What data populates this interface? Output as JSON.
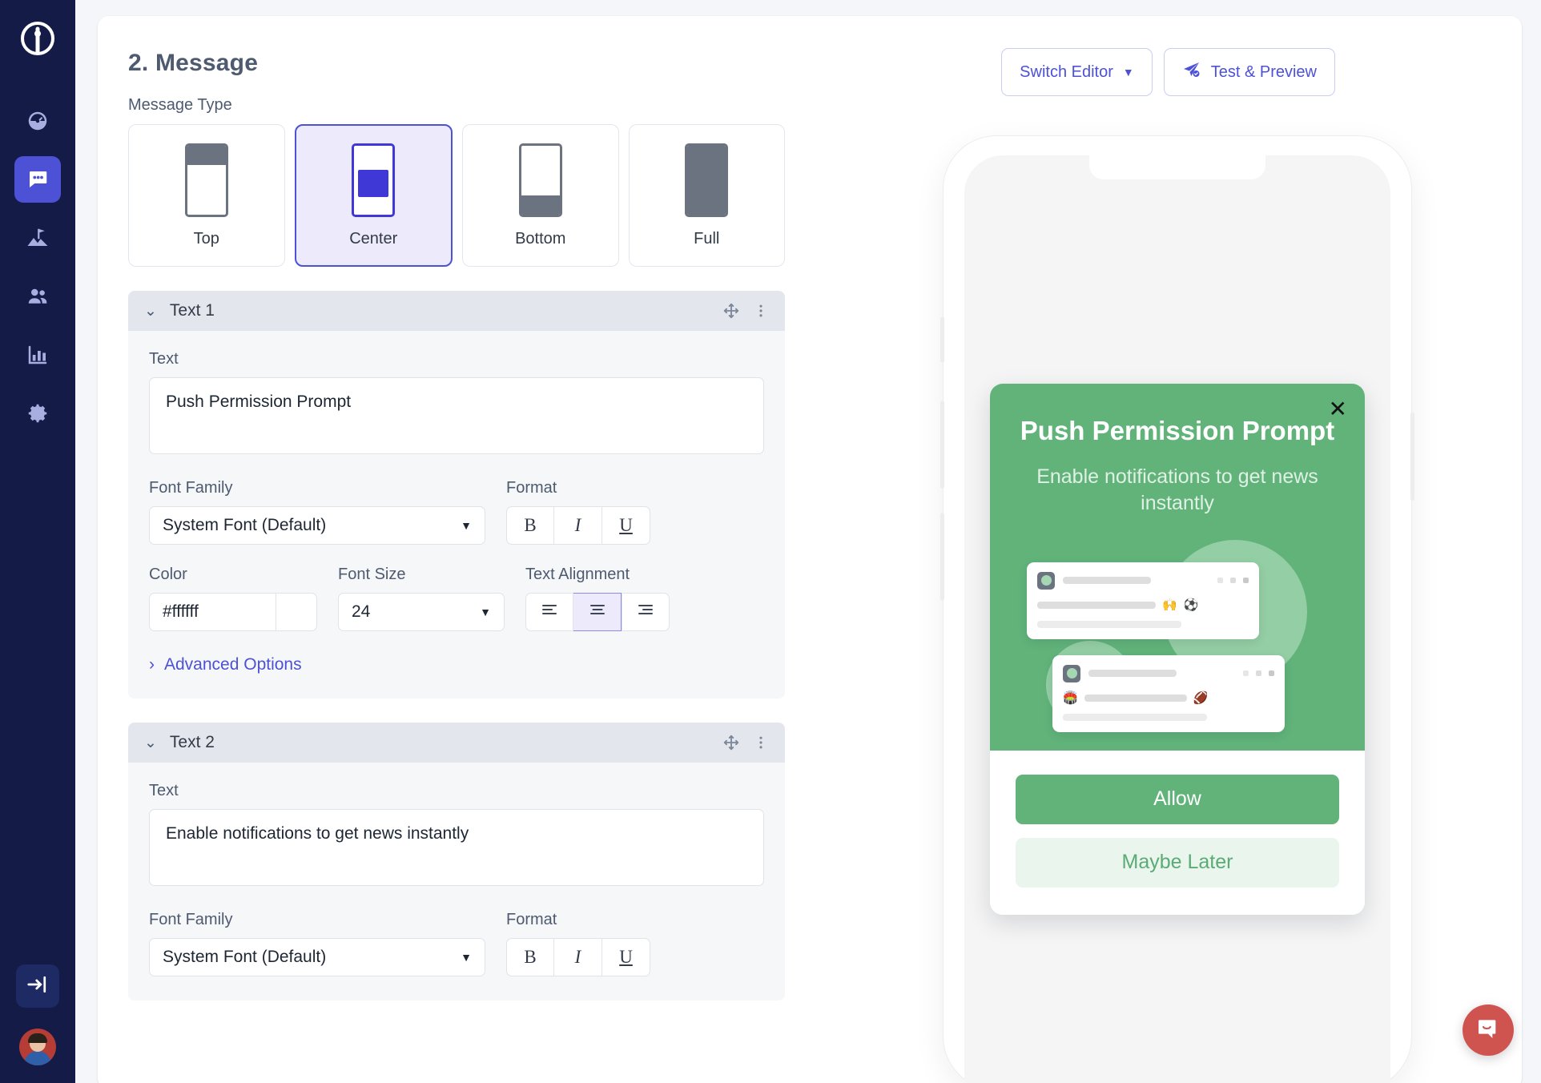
{
  "sidebar": {
    "logo_icon": "clevertap-logo-icon",
    "items": [
      {
        "icon": "dashboard-gauge-icon",
        "name": "dashboard",
        "active": false
      },
      {
        "icon": "campaign-message-icon",
        "name": "campaigns",
        "active": true
      },
      {
        "icon": "journey-flag-icon",
        "name": "journeys",
        "active": false
      },
      {
        "icon": "segments-people-icon",
        "name": "segments",
        "active": false
      },
      {
        "icon": "analytics-bar-chart-icon",
        "name": "analytics",
        "active": false
      },
      {
        "icon": "settings-gear-icon",
        "name": "settings",
        "active": false
      }
    ],
    "collapse_icon": "collapse-arrow-icon",
    "avatar_name": "user-avatar"
  },
  "header": {
    "title": "2. Message",
    "switch_editor_label": "Switch Editor",
    "switch_editor_caret": "▼",
    "test_preview_label": "Test & Preview",
    "test_preview_icon": "paper-plane-check-icon"
  },
  "message_type": {
    "label": "Message Type",
    "options": [
      {
        "label": "Top",
        "glyph": "phone-top-icon",
        "selected": false
      },
      {
        "label": "Center",
        "glyph": "phone-center-icon",
        "selected": true
      },
      {
        "label": "Bottom",
        "glyph": "phone-bottom-icon",
        "selected": false
      },
      {
        "label": "Full",
        "glyph": "phone-full-icon",
        "selected": false
      }
    ]
  },
  "panels": [
    {
      "title": "Text 1",
      "chevron": "⌄",
      "text_label": "Text",
      "text_value": "Push Permission Prompt",
      "font_family_label": "Font Family",
      "font_family_value": "System Font (Default)",
      "format_label": "Format",
      "format_buttons": [
        "B",
        "I",
        "U"
      ],
      "color_label": "Color",
      "color_value": "#ffffff",
      "font_size_label": "Font Size",
      "font_size_value": "24",
      "alignment_label": "Text Alignment",
      "alignment_selected": "center",
      "advanced_label": "Advanced Options",
      "advanced_chevron": "›"
    },
    {
      "title": "Text 2",
      "chevron": "⌄",
      "text_label": "Text",
      "text_value": "Enable notifications to get news instantly",
      "font_family_label": "Font Family",
      "font_family_value": "System Font (Default)",
      "format_label": "Format",
      "format_buttons": [
        "B",
        "I",
        "U"
      ]
    }
  ],
  "preview": {
    "close_icon": "✕",
    "title": "Push Permission Prompt",
    "subtitle": "Enable notifications to get news instantly",
    "allow_label": "Allow",
    "later_label": "Maybe Later",
    "accent_green": "#61b37a",
    "later_bg": "#eaf5ee",
    "illustration": {
      "card1_emoji_1": "🙌",
      "card1_emoji_2": "⚽",
      "card2_emoji_1": "🏟️",
      "card2_emoji_2": "🏈"
    }
  },
  "support": {
    "icon": "intercom-chat-icon",
    "color": "#cf5450"
  }
}
